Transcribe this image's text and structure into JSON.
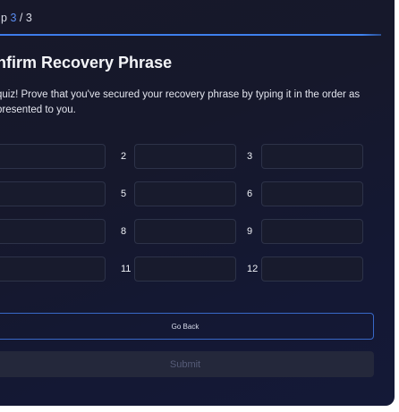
{
  "header": {
    "step_prefix": "p",
    "step_current": "3",
    "step_separator": " / ",
    "step_total": "3",
    "progress": 1.0
  },
  "page": {
    "title": "nfirm Recovery Phrase",
    "description": "quiz! Prove that you've secured your recovery phrase by typing it in the order as presented to you."
  },
  "words": [
    {
      "num": "",
      "value": ""
    },
    {
      "num": "2",
      "value": ""
    },
    {
      "num": "3",
      "value": ""
    },
    {
      "num": "",
      "value": ""
    },
    {
      "num": "5",
      "value": ""
    },
    {
      "num": "6",
      "value": ""
    },
    {
      "num": "",
      "value": ""
    },
    {
      "num": "8",
      "value": ""
    },
    {
      "num": "9",
      "value": ""
    },
    {
      "num": "",
      "value": ""
    },
    {
      "num": "11",
      "value": ""
    },
    {
      "num": "12",
      "value": ""
    }
  ],
  "actions": {
    "back_label": "Go Back",
    "submit_label": "Submit"
  },
  "colors": {
    "accent": "#3f83f0",
    "panel_bg": "#16182b",
    "submit_disabled_bg": "#24283b"
  }
}
